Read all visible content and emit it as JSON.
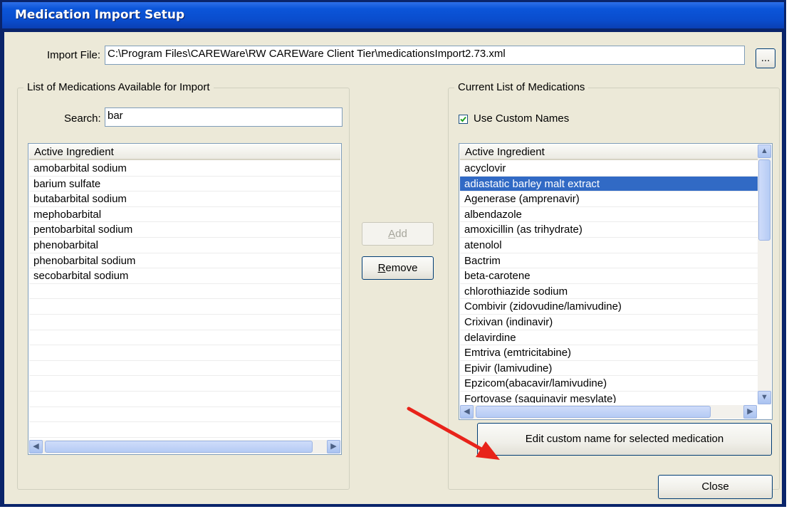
{
  "window": {
    "title": "Medication Import Setup"
  },
  "import_file": {
    "label": "Import File:",
    "value": "C:\\Program Files\\CAREWare\\RW CAREWare Client Tier\\medicationsImport2.73.xml",
    "browse_label": "..."
  },
  "available": {
    "group_title": "List of Medications Available for Import",
    "search_label": "Search:",
    "search_value": "bar",
    "column_header": "Active Ingredient",
    "items": [
      "amobarbital sodium",
      "barium sulfate",
      "butabarbital sodium",
      "mephobarbital",
      "pentobarbital sodium",
      "phenobarbital",
      "phenobarbital sodium",
      "secobarbital sodium"
    ]
  },
  "actions": {
    "add_prefix": "",
    "add_mnemonic": "A",
    "add_suffix": "dd",
    "remove_mnemonic": "R",
    "remove_suffix": "emove"
  },
  "current": {
    "group_title": "Current List of Medications",
    "use_custom_names_label": "Use Custom Names",
    "use_custom_names_checked": true,
    "column_header": "Active Ingredient",
    "selected_index": 1,
    "items": [
      "acyclovir",
      "adiastatic barley malt extract",
      "Agenerase (amprenavir)",
      "albendazole",
      "amoxicillin (as trihydrate)",
      "atenolol",
      "Bactrim",
      "beta-carotene",
      "chlorothiazide sodium",
      "Combivir (zidovudine/lamivudine)",
      "Crixivan (indinavir)",
      "delavirdine",
      "Emtriva (emtricitabine)",
      "Epivir (lamivudine)",
      "Epzicom(abacavir/lamivudine)",
      "Fortovase (saquinavir mesylate)"
    ],
    "edit_button_label": "Edit custom name for selected medication"
  },
  "close_label": "Close",
  "annotation_color": "#e8231a"
}
